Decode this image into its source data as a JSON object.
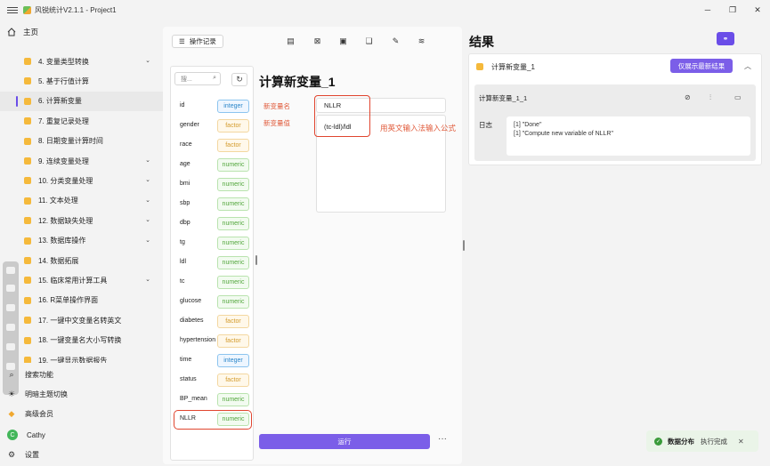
{
  "window": {
    "title": "风锐统计V2.1.1 - Project1",
    "controls": [
      "─",
      "❐",
      "✕"
    ]
  },
  "sidebar": {
    "home_label": "主页",
    "items": [
      {
        "label": "4. 变量类型转换",
        "chevron": true
      },
      {
        "label": "5. 基于行值计算",
        "chevron": false
      },
      {
        "label": "6. 计算新变量",
        "chevron": false
      },
      {
        "label": "7. 重复记录处理",
        "chevron": false
      },
      {
        "label": "8. 日期变量计算时间",
        "chevron": false
      },
      {
        "label": "9. 连续变量处理",
        "chevron": true
      },
      {
        "label": "10. 分类变量处理",
        "chevron": true
      },
      {
        "label": "11. 文本处理",
        "chevron": true
      },
      {
        "label": "12. 数据缺失处理",
        "chevron": true
      },
      {
        "label": "13. 数据库操作",
        "chevron": true
      },
      {
        "label": "14. 数据拓展",
        "chevron": false
      },
      {
        "label": "15. 临床常用计算工具",
        "chevron": true
      },
      {
        "label": "16. R菜单操作界面",
        "chevron": false
      },
      {
        "label": "17. 一键中文变量名转英文",
        "chevron": false
      },
      {
        "label": "18. 一键变量名大小写转换",
        "chevron": false
      },
      {
        "label": "19. 一键显示数据报告",
        "chevron": false
      }
    ],
    "active_index": 2,
    "bottom": {
      "search": "搜索功能",
      "theme": "明暗主题切换",
      "vip": "高级会员",
      "user": "Cathy",
      "user_initial": "C",
      "settings": "设置"
    }
  },
  "toolbar": {
    "history_label": "操作记录"
  },
  "variables": {
    "search_placeholder": "搜...",
    "list": [
      {
        "name": "id",
        "type": "integer"
      },
      {
        "name": "gender",
        "type": "factor"
      },
      {
        "name": "race",
        "type": "factor"
      },
      {
        "name": "age",
        "type": "numeric"
      },
      {
        "name": "bmi",
        "type": "numeric"
      },
      {
        "name": "sbp",
        "type": "numeric"
      },
      {
        "name": "dbp",
        "type": "numeric"
      },
      {
        "name": "tg",
        "type": "numeric"
      },
      {
        "name": "ldl",
        "type": "numeric"
      },
      {
        "name": "tc",
        "type": "numeric"
      },
      {
        "name": "glucose",
        "type": "numeric"
      },
      {
        "name": "diabetes",
        "type": "factor"
      },
      {
        "name": "hypertension",
        "type": "factor"
      },
      {
        "name": "time",
        "type": "integer"
      },
      {
        "name": "status",
        "type": "factor"
      },
      {
        "name": "BP_mean",
        "type": "numeric"
      },
      {
        "name": "NLLR",
        "type": "numeric"
      }
    ]
  },
  "form": {
    "title": "计算新变量_1",
    "name_label": "新变量名",
    "name_value": "NLLR",
    "value_label": "新变量值",
    "value_text": "(tc-ldl)/ldl",
    "annotation": "用英文输入法输入公式",
    "run_label": "运行",
    "more": "···"
  },
  "results": {
    "title": "结果",
    "card_label": "计算新变量_1",
    "latest_button": "仅展示最新结果",
    "sub_title": "计算新变量_1_1",
    "log_label": "日志",
    "log_lines": [
      "[1] \"Done\"",
      "[1] \"Compute new variable of  NLLR\""
    ]
  },
  "toast": {
    "title": "数据分布",
    "message": "执行完成",
    "close": "✕"
  },
  "colors": {
    "accent": "#6a4de8",
    "highlight": "#e0452f",
    "integer": "#2a86c9",
    "factor": "#d39b2c",
    "numeric": "#52a63c"
  }
}
